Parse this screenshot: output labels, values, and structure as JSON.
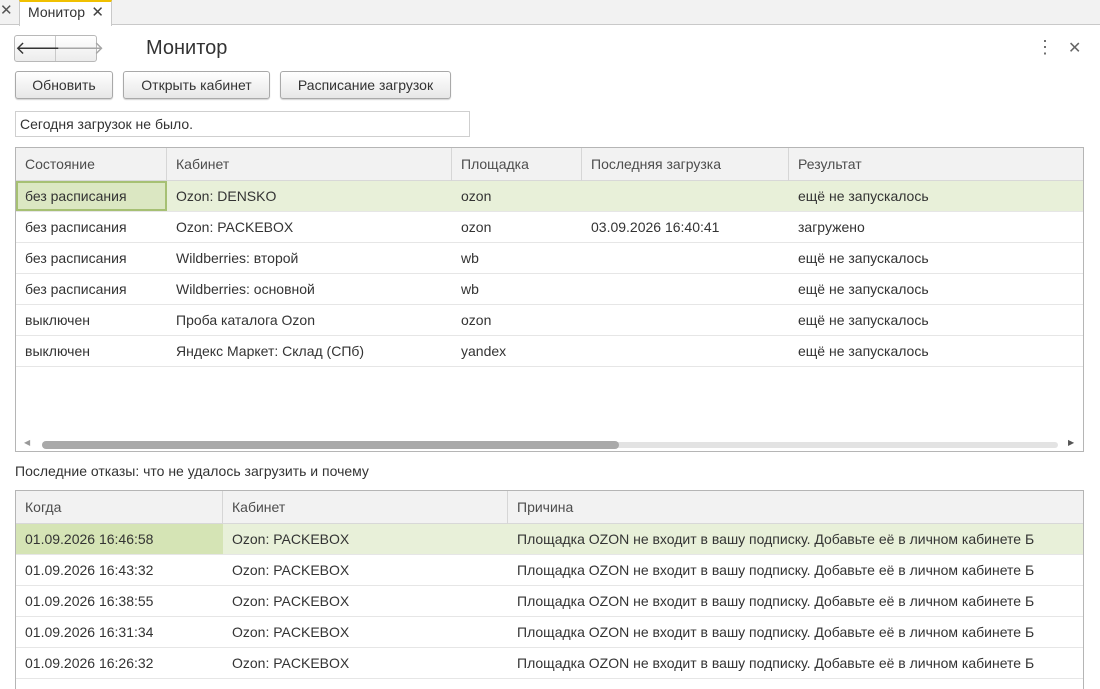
{
  "tabs": [
    {
      "label": "Монитор",
      "active": true
    }
  ],
  "header": {
    "title": "Монитор"
  },
  "toolbar": {
    "refresh_label": "Обновить",
    "open_cabinet_label": "Открыть кабинет",
    "schedule_label": "Расписание загрузок"
  },
  "status_text": "Сегодня загрузок не было.",
  "schedule_table": {
    "columns": [
      "Состояние",
      "Кабинет",
      "Площадка",
      "Последняя загрузка",
      "Результат"
    ],
    "rows": [
      {
        "state": "без расписания",
        "cabinet": "Ozon: DENSKO",
        "platform": "ozon",
        "last_load": "",
        "result": "ещё не запускалось",
        "selected": true
      },
      {
        "state": "без расписания",
        "cabinet": "Ozon: PACKEBOX",
        "platform": "ozon",
        "last_load": "03.09.2026 16:40:41",
        "result": "загружено"
      },
      {
        "state": "без расписания",
        "cabinet": "Wildberries: второй",
        "platform": "wb",
        "last_load": "",
        "result": "ещё не запускалось"
      },
      {
        "state": "без расписания",
        "cabinet": "Wildberries: основной",
        "platform": "wb",
        "last_load": "",
        "result": "ещё не запускалось"
      },
      {
        "state": "выключен",
        "cabinet": "Проба каталога Ozon",
        "platform": "ozon",
        "last_load": "",
        "result": "ещё не запускалось"
      },
      {
        "state": "выключен",
        "cabinet": "Яндекс Маркет: Склад (СПб)",
        "platform": "yandex",
        "last_load": "",
        "result": "ещё не запускалось"
      }
    ]
  },
  "failures_caption": "Последние отказы: что не удалось загрузить и почему",
  "failures_table": {
    "columns": [
      "Когда",
      "Кабинет",
      "Причина"
    ],
    "rows": [
      {
        "when": "01.09.2026 16:46:58",
        "cabinet": "Ozon: PACKEBOX",
        "reason": "Площадка OZON не входит в вашу подписку. Добавьте её в личном кабинете Б",
        "selected": true
      },
      {
        "when": "01.09.2026 16:43:32",
        "cabinet": "Ozon: PACKEBOX",
        "reason": "Площадка OZON не входит в вашу подписку. Добавьте её в личном кабинете Б"
      },
      {
        "when": "01.09.2026 16:38:55",
        "cabinet": "Ozon: PACKEBOX",
        "reason": "Площадка OZON не входит в вашу подписку. Добавьте её в личном кабинете Б"
      },
      {
        "when": "01.09.2026 16:31:34",
        "cabinet": "Ozon: PACKEBOX",
        "reason": "Площадка OZON не входит в вашу подписку. Добавьте её в личном кабинете Б"
      },
      {
        "when": "01.09.2026 16:26:32",
        "cabinet": "Ozon: PACKEBOX",
        "reason": "Площадка OZON не входит в вашу подписку. Добавьте её в личном кабинете Б"
      }
    ]
  },
  "colors": {
    "tab_accent": "#f0c000",
    "selection": "#e8f0d9",
    "focus_border": "#a6c073"
  }
}
